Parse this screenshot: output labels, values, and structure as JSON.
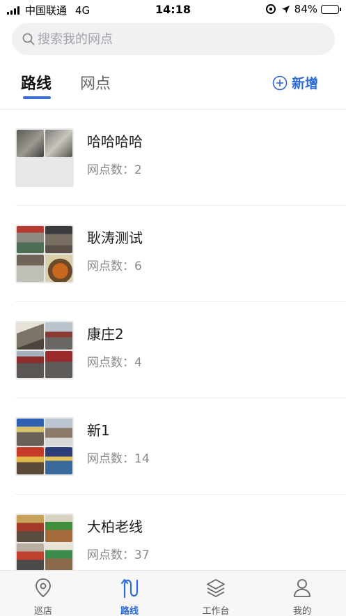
{
  "status_bar": {
    "carrier": "中国联通",
    "network": "4G",
    "time": "14:18",
    "battery": "84%",
    "battery_level": 0.84
  },
  "search": {
    "placeholder": "搜索我的网点"
  },
  "tabs": [
    {
      "label": "路线",
      "active": true
    },
    {
      "label": "网点",
      "active": false
    }
  ],
  "add_button": {
    "label": "新增"
  },
  "routes": [
    {
      "name": "哈哈哈哈",
      "count_text": "网点数：2"
    },
    {
      "name": "耿涛测试",
      "count_text": "网点数：6"
    },
    {
      "name": "康庄2",
      "count_text": "网点数：4"
    },
    {
      "name": "新1",
      "count_text": "网点数：14"
    },
    {
      "name": "大柏老线",
      "count_text": "网点数：37"
    }
  ],
  "bottom_nav": [
    {
      "label": "巡店",
      "icon": "location-pin-icon",
      "active": false
    },
    {
      "label": "路线",
      "icon": "route-icon",
      "active": true
    },
    {
      "label": "工作台",
      "icon": "layers-icon",
      "active": false
    },
    {
      "label": "我的",
      "icon": "user-icon",
      "active": false
    }
  ],
  "colors": {
    "accent": "#2c6bd6",
    "text_primary": "#1c1c1c",
    "text_secondary": "#8a8a8a",
    "search_bg": "#f0f1f3"
  }
}
